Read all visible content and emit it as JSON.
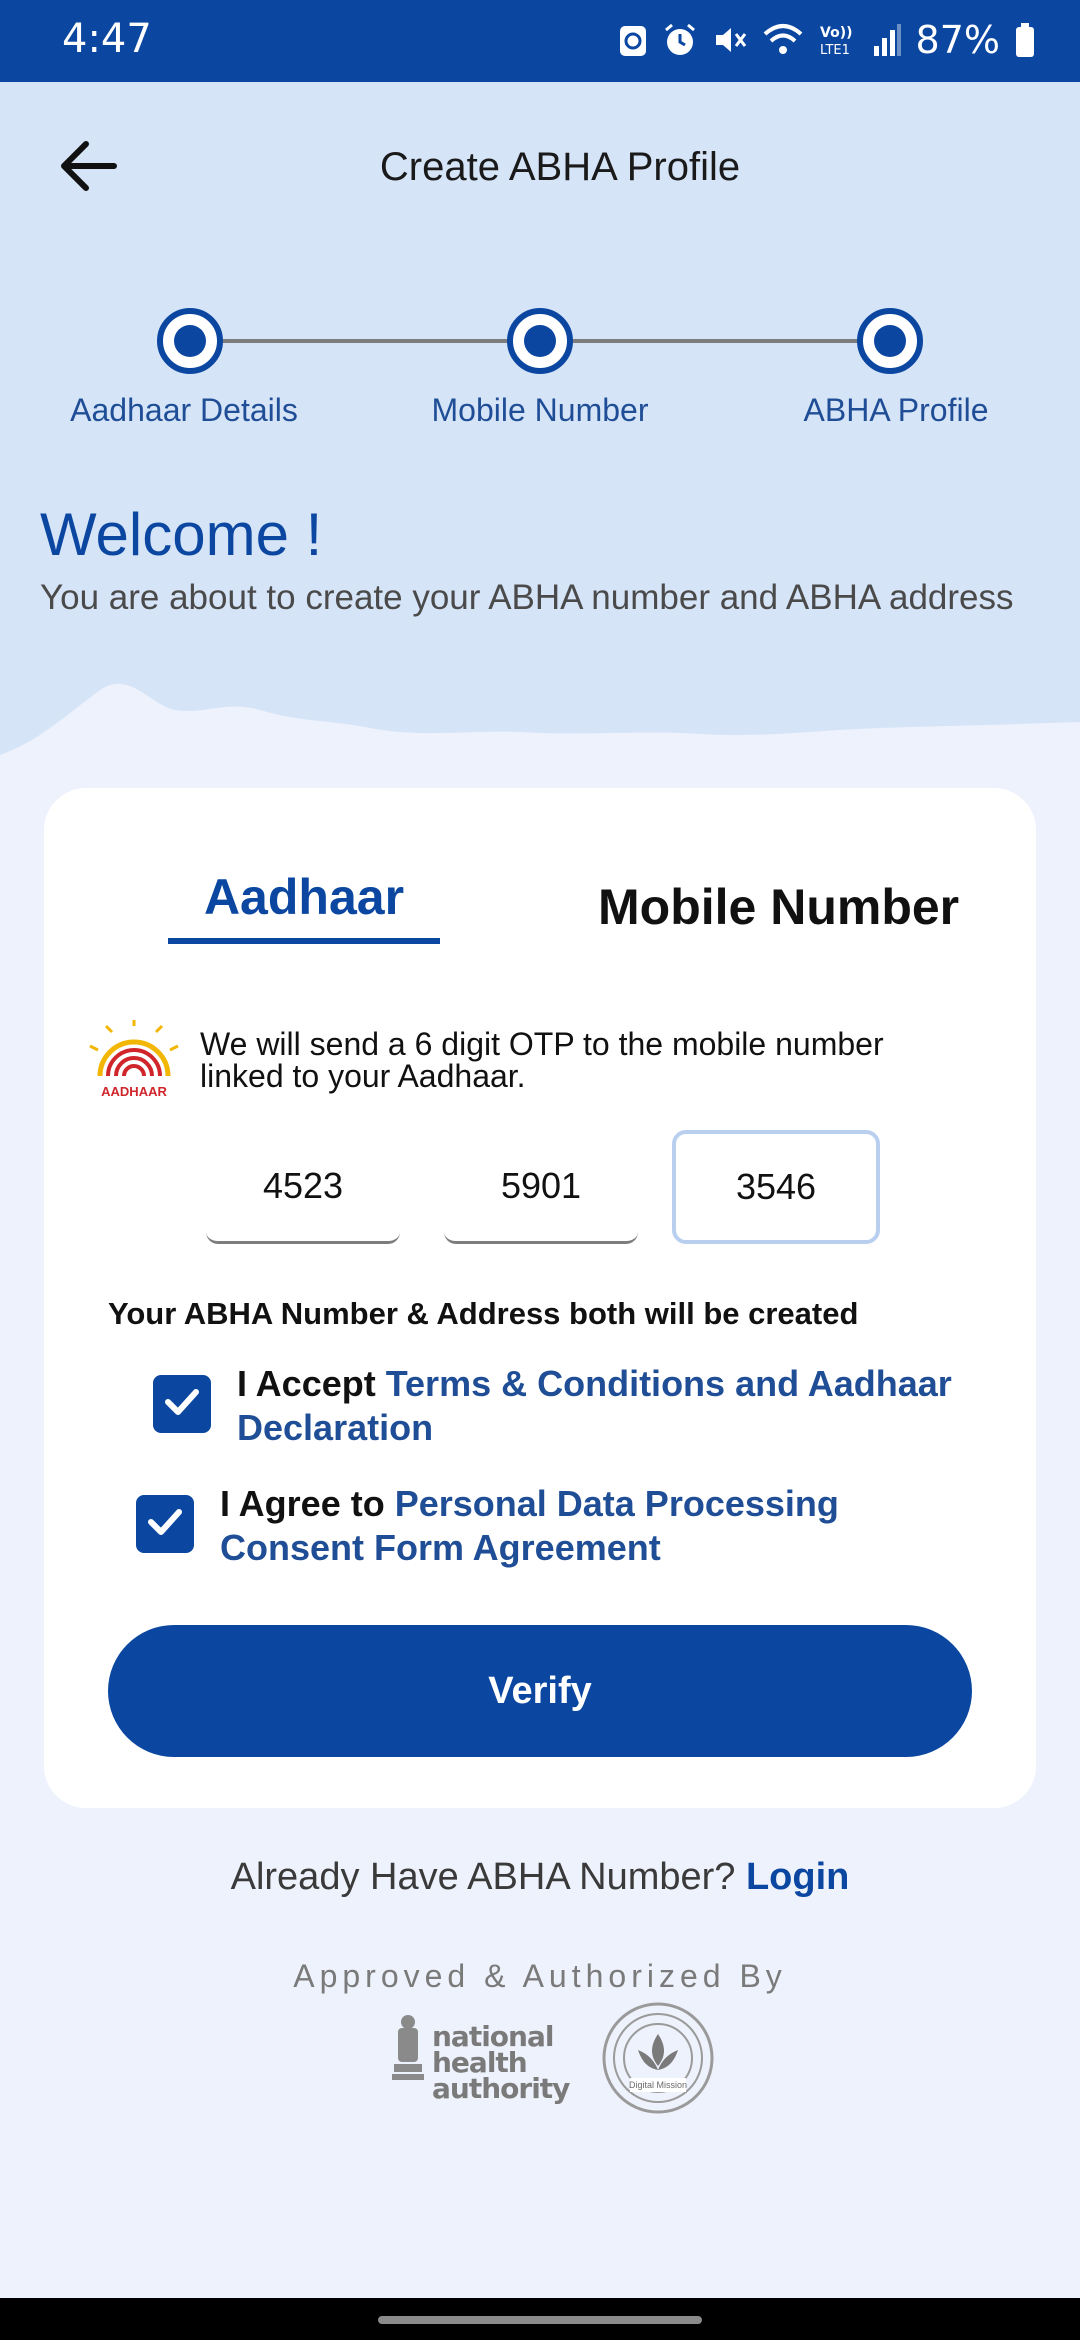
{
  "status_bar": {
    "time": "4:47",
    "battery": "87%",
    "icons": [
      "recycle-icon",
      "alarm-icon",
      "mute-icon",
      "wifi-icon",
      "volte-icon",
      "signal-icon",
      "battery-icon"
    ],
    "volte_label": "Vo)) LTE1"
  },
  "header": {
    "title": "Create ABHA Profile",
    "back_icon": "arrow-left-icon"
  },
  "stepper": {
    "steps": [
      {
        "label": "Aadhaar Details"
      },
      {
        "label": "Mobile Number"
      },
      {
        "label": "ABHA Profile"
      }
    ]
  },
  "welcome": {
    "title": "Welcome !",
    "subtitle": "You are about to create your ABHA number and ABHA address"
  },
  "tabs": {
    "aadhaar": "Aadhaar",
    "mobile": "Mobile Number"
  },
  "aadhaar_logo_text": "AADHAAR",
  "otp_info": "We will send a 6 digit OTP to the mobile number linked to your Aadhaar.",
  "aadhaar_fields": [
    "4523",
    "5901",
    "3546"
  ],
  "create_note": "Your ABHA Number & Address both will be created",
  "consents": {
    "terms_prefix": "I Accept ",
    "terms_link": "Terms & Conditions and Aadhaar Declaration",
    "terms_checked": true,
    "data_prefix": "I Agree to ",
    "data_link": "Personal Data Processing Consent Form Agreement",
    "data_checked": true
  },
  "verify_label": "Verify",
  "login": {
    "prompt": "Already Have ABHA Number? ",
    "link": "Login"
  },
  "footer": {
    "approved_by": "Approved & Authorized By",
    "nha_logo_text": "national health authority",
    "ndhm_logo_text": "Ayushman Bharat Digital Mission"
  },
  "colors": {
    "primary": "#0b47a1",
    "hero_bg": "#d6e4f8",
    "page_bg": "#eef2fc",
    "link": "#1f4e96"
  }
}
